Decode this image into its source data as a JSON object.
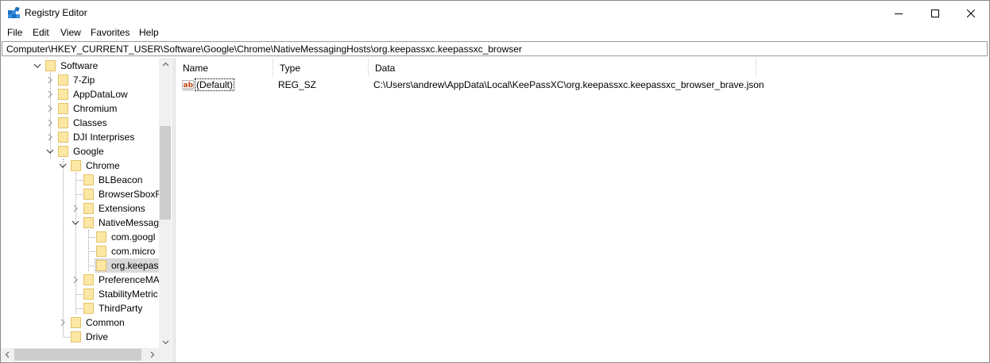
{
  "window": {
    "title": "Registry Editor",
    "icon": "registry-editor-icon",
    "caption_buttons": [
      "minimize-icon",
      "maximize-icon",
      "close-icon"
    ]
  },
  "menu": [
    "File",
    "Edit",
    "View",
    "Favorites",
    "Help"
  ],
  "address": {
    "path": "Computer\\HKEY_CURRENT_USER\\Software\\Google\\Chrome\\NativeMessagingHosts\\org.keepassxc.keepassxc_browser"
  },
  "tree": {
    "items": [
      {
        "label": "Software",
        "state": "expanded"
      },
      {
        "label": "7-Zip",
        "state": "collapsed"
      },
      {
        "label": "AppDataLow",
        "state": "collapsed"
      },
      {
        "label": "Chromium",
        "state": "collapsed"
      },
      {
        "label": "Classes",
        "state": "collapsed"
      },
      {
        "label": "DJI Interprises",
        "state": "collapsed"
      },
      {
        "label": "Google",
        "state": "expanded"
      },
      {
        "label": "Chrome",
        "state": "expanded"
      },
      {
        "label": "BLBeacon",
        "state": "leaf"
      },
      {
        "label": "BrowserSboxF",
        "state": "leaf"
      },
      {
        "label": "Extensions",
        "state": "collapsed"
      },
      {
        "label": "NativeMessag",
        "state": "expanded"
      },
      {
        "label": "com.googl",
        "state": "leaf"
      },
      {
        "label": "com.micro",
        "state": "leaf"
      },
      {
        "label": "org.keepass",
        "state": "selected"
      },
      {
        "label": "PreferenceMA",
        "state": "collapsed"
      },
      {
        "label": "StabilityMetric",
        "state": "leaf"
      },
      {
        "label": "ThirdParty",
        "state": "leaf"
      },
      {
        "label": "Common",
        "state": "collapsed"
      },
      {
        "label": "Drive",
        "state": "leaf"
      }
    ]
  },
  "list": {
    "columns": [
      "Name",
      "Type",
      "Data"
    ],
    "rows": [
      {
        "name": "(Default)",
        "type": "REG_SZ",
        "data": "C:\\Users\\andrew\\AppData\\Local\\KeePassXC\\org.keepassxc.keepassxc_browser_brave.json",
        "icon": "string-value-icon"
      }
    ]
  },
  "colors": {
    "folder": "#fce7a4",
    "selection": "#d9d9d9",
    "value_icon": "#c1440e"
  }
}
